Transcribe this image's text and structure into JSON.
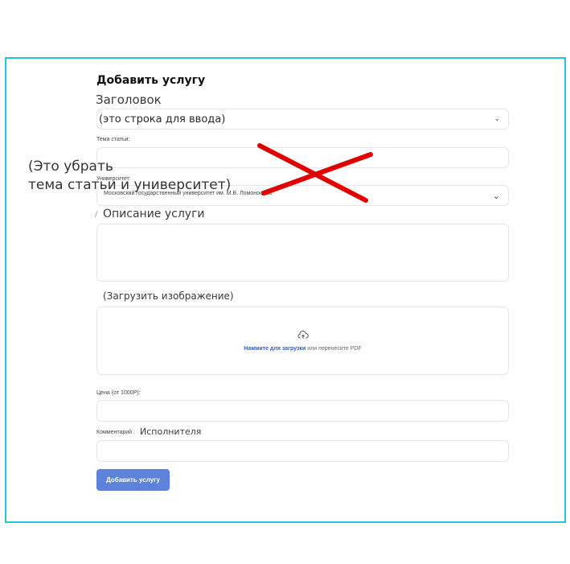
{
  "form": {
    "title": "Добавить услугу",
    "heading_label": "Заголовок",
    "heading_select_value": "(это строка для ввода)",
    "topic_label": "Тема статьи:",
    "university_label": "Университет:",
    "university_value": "Московский государственный университет им. М.В. Ломоносова",
    "description_label": "Описание услуги",
    "upload_label": "(Загрузить изображение)",
    "upload_link": "Нажмите для загрузки",
    "upload_hint": " или перенесите PDF",
    "price_label": "Цена (от 1000Р):",
    "comment_label": "Комментарий :",
    "comment_suffix": "Исполнителя",
    "submit_label": "Добавить услугу"
  },
  "annotation": {
    "line1": "(Это убрать",
    "line2": "тема статьи и университет)",
    "cross_color": "#e00000"
  },
  "colors": {
    "frame": "#25c3dc",
    "button": "#5c83d9",
    "link": "#2b5fd1"
  }
}
